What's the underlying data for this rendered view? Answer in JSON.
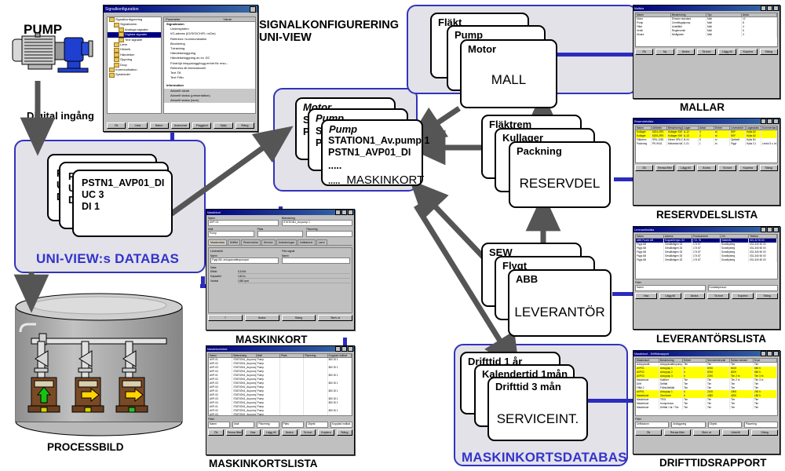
{
  "diagram": {
    "title_signal_config": "SIGNALKONFIGURERING",
    "title_signal_config2": "UNI-VIEW",
    "pump_label": "PUMP",
    "digital_input_label": "Digital ingång",
    "uniview_db_title": "UNI-VIEW:s DATABAS",
    "maskinkort_db_title": "MASKINKORTSDATABAS",
    "processbild_caption": "PROCESSBILD"
  },
  "signal_config_dialog": {
    "title": "Signalkonfiguration",
    "tree": [
      "Signalkonfigurering",
      "Signalnamn",
      "Analoga signaler",
      "Digitala signaler",
      "Text signaler",
      "Larm",
      "Historik",
      "Händelser",
      "Öppning",
      "Drop",
      "Kommunikation",
      "Systemdel"
    ],
    "tree_selected": "Digitala signaler",
    "columns": [
      "Parameter",
      "Värde"
    ],
    "parameters": [
      "Signalnamn",
      "Undersystem",
      "I/O-adress (IO/S/S/CH/FL mGm)",
      "Referens i kommunikation",
      "Blockering",
      "Tvinstning",
      "Händelseloggning",
      "Händelseloggning av ev. DC",
      "Fördröjd inloppslogg/logg.enhet för reso...",
      "Referens till internationell",
      "Text Till",
      "Text Från"
    ],
    "info_header": "Information",
    "info_rows": [
      "Aktuellt värde",
      "Aktuellt status (presentation)",
      "Aktuellt status (larm)"
    ],
    "buttons": [
      "Ök",
      "Lista",
      "Bakre",
      "Avancerat",
      "Flaggkod",
      "Hjälp",
      "Stäng"
    ]
  },
  "uniview_db_cards": [
    {
      "line1": "PSTN1_AVP03_DI",
      "line2": "UC 3",
      "line3": "DI 1"
    },
    {
      "line1": "PSTN1_AVP02_DI",
      "line2": "UC 3",
      "line3": "DI 1"
    },
    {
      "line1": "PSTN1_AVP01_DI",
      "line2": "UC 3",
      "line3": "DI 1"
    }
  ],
  "maskinkort_cards": {
    "titles": [
      "Motor",
      "Pump",
      "Pump"
    ],
    "front": {
      "title": "Pump",
      "line1": "STATION1_Av.pump 1",
      "line2": "PSTN1_AVP01_DI",
      "dots1": ".....",
      "big": "MASKINKORT",
      "dots2": "....."
    },
    "back_lines": [
      "ST",
      "PS"
    ]
  },
  "mall_cards": {
    "titles": [
      "Fläkt",
      "Pump",
      "Motor"
    ],
    "big": "MALL"
  },
  "reservdel_cards": {
    "titles": [
      "Fläktrem",
      "Kullager",
      "Packning"
    ],
    "big": "RESERVDEL"
  },
  "leverantor_cards": {
    "titles": [
      "SEW",
      "Flygt",
      "ABB"
    ],
    "big": "LEVERANTÖR"
  },
  "serviceint_cards": {
    "titles": [
      "Drifttid 1 år",
      "Kalendertid 1mån",
      "Drifttid 3 mån"
    ],
    "big": "SERVICEINT."
  },
  "windows": {
    "mallar": {
      "caption": "MALLAR",
      "title": "Mallista",
      "columns": [
        "Namn",
        "Beskrivning",
        "Typ",
        "Antal"
      ],
      "rows": [
        [
          "Motor",
          "Elmotor standard",
          "Mall",
          "12"
        ],
        [
          "Pump",
          "Centrifugalpump",
          "Mall",
          "8"
        ],
        [
          "Fläkt",
          "Axialfläkt",
          "Mall",
          "4"
        ],
        [
          "Ventil",
          "Reglerventil",
          "Mall",
          "6"
        ],
        [
          "Givare",
          "Nivågivare",
          "Mall",
          "3"
        ]
      ],
      "buttons": [
        "Ök",
        "Ny",
        "Ändra",
        "Ta bort",
        "Lägg till",
        "Kopiera",
        "Stäng"
      ]
    },
    "reservdelslista": {
      "caption": "RESERVDELSLISTA",
      "title": "Reservdelslista",
      "columns": [
        "Namn",
        "Artikelnr",
        "Beskrivning",
        "Lager",
        "Antal",
        "Enhet",
        "Leverantör",
        "Lagerplats",
        "Kommentar"
      ],
      "rows": [
        {
          "cells": [
            "Kullager",
            "6204-2RS",
            "Kullager SKF 6204",
            "A-12",
            "4",
            "st",
            "SKF",
            "Hylla A2",
            ""
          ],
          "highlight": "yellow"
        },
        {
          "cells": [
            "Kullager",
            "6205-2RS",
            "Kullager SKF 6205",
            "A-13",
            "2",
            "st",
            "SKF",
            "Hylla A2",
            ""
          ],
          "highlight": "yellow"
        },
        {
          "cells": [
            "Fläktrem",
            "SPA-1250",
            "Kilrem SPA 1250",
            "B-04",
            "6",
            "st",
            "Optibelt",
            "Hylla B1",
            ""
          ],
          "highlight": "none"
        },
        {
          "cells": [
            "Packning",
            "PK-9041",
            "Mekanisk tätning",
            "C-01",
            "1",
            "st",
            "Flygt",
            "Hylla C1",
            "Levtid 3 v, beställd"
          ],
          "highlight": "none"
        }
      ],
      "filter_label": "Filter",
      "buttons": [
        "Ök",
        "Rensa filter",
        "Lägg till",
        "Ändra",
        "Ta bort",
        "Kopiera",
        "Stäng"
      ]
    },
    "leverantorslista": {
      "caption": "LEVERANTÖRSLISTA",
      "title": "Leverantörslista",
      "columns": [
        "Namn",
        "Adress",
        "Postnummer",
        "Ort",
        "Telefon"
      ],
      "rows": [
        {
          "cells": [
            "ABB Power AB",
            "Kopparbergsv. 84",
            "721 78",
            "Västerås",
            "021-32 50 00"
          ],
          "selected": true
        },
        {
          "cells": [
            "Flygt AB",
            "Gesällvägen 33",
            "174 87",
            "Sundbyberg",
            "031-340 60 00"
          ],
          "selected": false
        },
        {
          "cells": [
            "Flygt AB",
            "Gesällvägen 33",
            "174 87",
            "Sundbyberg",
            "031-340 60 00"
          ],
          "selected": false
        },
        {
          "cells": [
            "Flygt AB",
            "Gesällvägen 33",
            "174 87",
            "Sundbyberg",
            "031-340 60 00"
          ],
          "selected": false
        },
        {
          "cells": [
            "Flygt AB",
            "Gesällvägen 33",
            "174 87",
            "Sundbyberg",
            "031-340 60 00"
          ],
          "selected": false
        },
        {
          "cells": [
            "Flygt AB",
            "Gesällvägen 33",
            "174 87",
            "Sundbyberg",
            "031-340 60 00"
          ],
          "selected": false
        }
      ],
      "filter_label": "Filter",
      "filter_fields": [
        "Namn",
        "Kontaktperson"
      ],
      "buttons": [
        "Visa",
        "Lägg till",
        "Ändra",
        "Ta bort",
        "Kopiera",
        "Stäng"
      ]
    },
    "drifttidsrapport": {
      "caption": "DRIFTTIDSRAPPORT",
      "title": "Maskinkort - Drifttidsrapport",
      "columns": [
        "Maskinkort",
        "Beskrivning",
        "Enhet",
        "Serviceintervall",
        "Sedan senast",
        "Kvar"
      ],
      "rows": [
        {
          "cells": [
            "Avloppsvatt",
            "Avloppsvattenpump",
            "Tim",
            "Tim",
            "Tim",
            "Tim"
          ],
          "highlight": "none"
        },
        {
          "cells": [
            "AVP01",
            "Avloppsp 1",
            "h",
            "8760",
            "8100",
            "660 h"
          ],
          "highlight": "yellow"
        },
        {
          "cells": [
            "AVP02",
            "Avloppsp 2",
            "h",
            "8760",
            "8200",
            "560 h"
          ],
          "highlight": "yellow"
        },
        {
          "cells": [
            "AVP03",
            "Avloppsp 3",
            "h",
            "2190",
            "Tim 2 m",
            "Tim 3 m"
          ],
          "highlight": "yellow"
        },
        {
          "cells": [
            "Maskinkort",
            "Kalibrer",
            "Tim",
            "Tim",
            "Tim 2 m",
            "Tim 3 m"
          ],
          "highlight": "none"
        },
        {
          "cells": [
            "Drift",
            "Drifttid",
            "Tim",
            "Tim",
            "Tim",
            "Tim"
          ],
          "highlight": "none"
        },
        {
          "cells": [
            "Fläkt 2",
            "Frånluftsfläkt",
            "Tim",
            "Tim",
            "Tim",
            "Tim"
          ],
          "highlight": "none"
        },
        {
          "cells": [
            "AVP01",
            "Avloppsp 1",
            "h",
            "2190",
            "1900",
            "290 h"
          ],
          "highlight": "yellow"
        },
        {
          "cells": [
            "Maskinkort",
            "Omrörare",
            "h",
            "4380",
            "4200",
            "180 h"
          ],
          "highlight": "yellow"
        },
        {
          "cells": [
            "Maskinkort",
            "TE01",
            "Tim",
            "Tim",
            "Tim",
            "Tim"
          ],
          "highlight": "none"
        },
        {
          "cells": [
            "Maskinkort",
            "Kompressor",
            "Tim",
            "Tim",
            "Tim",
            "Tim"
          ],
          "highlight": "none"
        },
        {
          "cells": [
            "Maskinkort",
            "Drifttid 1 år / Tim",
            "Tim",
            "Tim",
            "Tim",
            "Tim"
          ],
          "highlight": "none"
        }
      ],
      "filter_label": "Filter",
      "filter_fields": [
        "Driftdatum",
        "Anläggning",
        "Objekt",
        "Placering"
      ],
      "buttons": [
        "Ök",
        "Rensa filter",
        "Skriv ut",
        "Utskrift",
        "Stäng"
      ]
    },
    "maskinkort": {
      "caption": "MASKINKORT",
      "title": "Maskinkort",
      "field_labels": [
        "Namn",
        "Beteckning",
        "Mall",
        "Plats",
        "Placering"
      ],
      "field_values": [
        "AVP-01",
        "STATION1_Av.pump 1",
        "Pump",
        "",
        ""
      ],
      "tabs": [
        "Maskindata",
        "Drifttid",
        "Reservdelar",
        "Service",
        "Anteckningar",
        "Indikatorer",
        "Larm"
      ],
      "active_tab": "Maskindata",
      "section_left": "Leverantör",
      "section_right": "Film signal",
      "left_field_label": "Namn",
      "left_field_value": "Flygt AB, avloppsvattenpumpar",
      "right_field_label": "Namn",
      "data_header": "Data",
      "data_rows": [
        {
          "label": "Effekt",
          "value": "5,5 kW"
        },
        {
          "label": "Kapacitet",
          "value": "140 l/s"
        },
        {
          "label": "Varvtal",
          "value": "1450 rpm"
        }
      ],
      "buttons": [
        "?",
        "Ändra",
        "Stäng",
        "Skriv ut"
      ]
    },
    "maskinkortslista": {
      "caption": "MASKINKORTSLISTA",
      "title": "Maskinkortslista",
      "columns": [
        "Namn",
        "Beteckning",
        "Mall",
        "Plats",
        "Placering",
        "Kopplad indikat."
      ],
      "rows": [
        [
          "AVP-01",
          "STATION1_Av.pump 1",
          "Pump",
          "",
          "",
          "800 DI 1"
        ],
        [
          "AVP-02",
          "STATION1_Av.pump 2",
          "Pump",
          "",
          "",
          ""
        ],
        [
          "AVP-03",
          "STATION1_Av.pump 3",
          "Pump",
          "",
          "",
          "800 DI 1"
        ],
        [
          "AVP-04",
          "STATION1_Av.pump 4",
          "Pump",
          "",
          "",
          ""
        ],
        [
          "AVP-01",
          "STATION1_Av.pump 1",
          "Pump",
          "",
          "",
          "800 DI 1"
        ],
        [
          "AVP-02",
          "STATION1_Av.pump 2",
          "Pump",
          "",
          "",
          ""
        ],
        [
          "AVP-03",
          "STATION1_Av.pump 3",
          "Pump",
          "",
          "",
          "800 DI 1"
        ],
        [
          "AVP-04",
          "STATION1_Av.pump 4",
          "Pump",
          "",
          "",
          ""
        ],
        [
          "AVP-01",
          "STATION1_Av.pump 1",
          "Pump",
          "",
          "",
          "800 DI 1"
        ],
        [
          "AVP-02",
          "STATION1_Av.pump 2",
          "Pump",
          "",
          "",
          ""
        ],
        [
          "AVP-03",
          "STATION1_Av.pump 3",
          "Pump",
          "",
          "",
          "800 DI 1"
        ],
        [
          "AVP-04",
          "STATION1_Av.pump 4",
          "Pump",
          "",
          "",
          "800 DI 1"
        ],
        [
          "AVP-01",
          "STATION1_Av.pump 1",
          "Pump",
          "",
          "",
          ""
        ],
        [
          "AVP-02",
          "STATION1_Av.pump 2",
          "Pump",
          "",
          "",
          "800 DI 1"
        ],
        [
          "AVP-03",
          "STATION1_Av.pump 3",
          "Pump",
          "",
          "",
          ""
        ]
      ],
      "filter_label": "Filter",
      "filter_fields": [
        "Namn",
        "Mall",
        "Placering",
        "Plats",
        "Objekt",
        "Kopplad indikat."
      ],
      "buttons": [
        "Ök",
        "Rensa filter",
        "Visa",
        "Lägg till",
        "Ändra",
        "Ta bort",
        "Kopiera",
        "Stäng"
      ]
    }
  },
  "colors": {
    "group_border": "#3333bb",
    "group_fill": "#e2e2e8",
    "group_title": "#3333cc",
    "arrow": "#555555",
    "blue_connector": "#2b2bbe",
    "highlight_yellow": "#ffff00",
    "selection_blue": "#000080"
  }
}
